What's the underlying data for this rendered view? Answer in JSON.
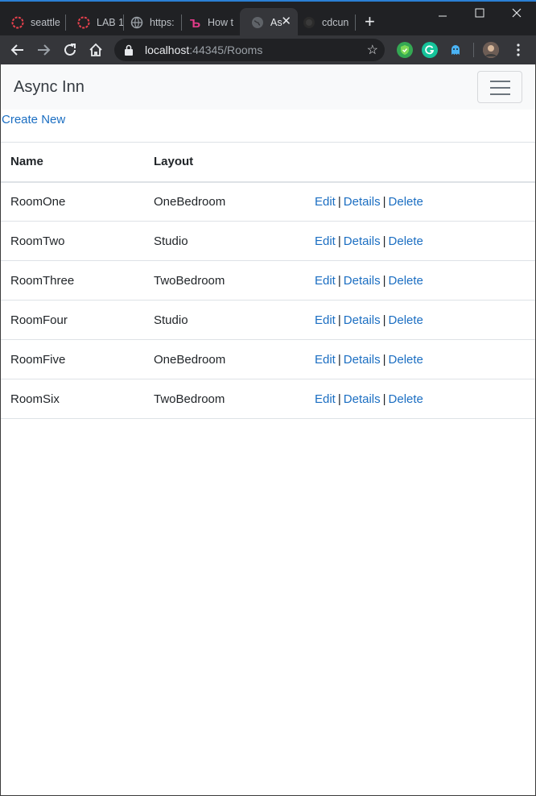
{
  "browser": {
    "tabs": [
      {
        "label": "seattle",
        "icon": "codefellows-icon"
      },
      {
        "label": "LAB 1",
        "icon": "codefellows-icon"
      },
      {
        "label": "https:",
        "icon": "globe-icon"
      },
      {
        "label": "How t",
        "icon": "td-icon"
      },
      {
        "label": "As",
        "icon": "globe-icon",
        "active": true
      },
      {
        "label": "cdcun",
        "icon": "github-icon"
      }
    ],
    "new_tab": "+",
    "url_host": "localhost",
    "url_rest": ":44345/Rooms"
  },
  "navbar": {
    "brand": "Async Inn"
  },
  "links": {
    "create_new": "Create New"
  },
  "table": {
    "headers": [
      "Name",
      "Layout",
      ""
    ],
    "rows": [
      {
        "name": "RoomOne",
        "layout": "OneBedroom"
      },
      {
        "name": "RoomTwo",
        "layout": "Studio"
      },
      {
        "name": "RoomThree",
        "layout": "TwoBedroom"
      },
      {
        "name": "RoomFour",
        "layout": "Studio"
      },
      {
        "name": "RoomFive",
        "layout": "OneBedroom"
      },
      {
        "name": "RoomSix",
        "layout": "TwoBedroom"
      }
    ],
    "actions": {
      "edit": "Edit",
      "details": "Details",
      "delete": "Delete",
      "separator": "|"
    }
  },
  "colors": {
    "link": "#1b6ec2",
    "navbar_bg": "#f8f9fa",
    "chrome_dark": "#202124"
  }
}
